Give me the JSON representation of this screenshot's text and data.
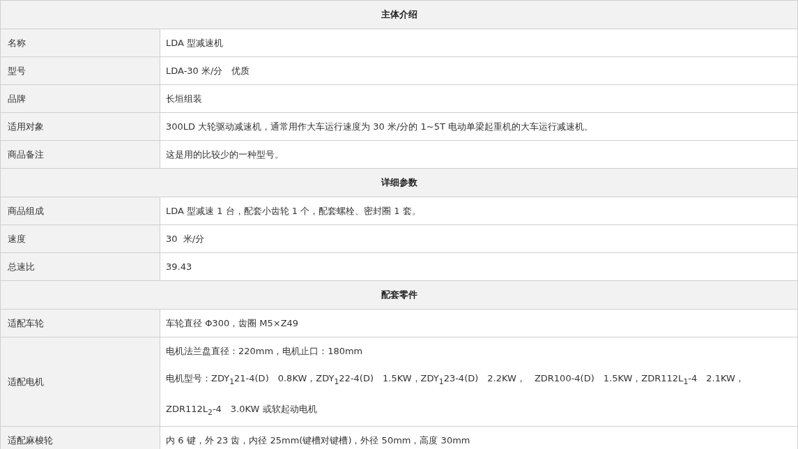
{
  "sections": [
    {
      "title": "主体介绍",
      "rows": [
        {
          "label": "名称",
          "value": [
            "LDA 型减速机"
          ]
        },
        {
          "label": "型号",
          "value": [
            "LDA-30 米/分　优质"
          ]
        },
        {
          "label": "品牌",
          "value": [
            "长垣组装"
          ]
        },
        {
          "label": "适用对象",
          "value": [
            "300LD 大轮驱动减速机，通常用作大车运行速度为 30 米/分的 1~5T 电动单梁起重机的大车运行减速机。"
          ]
        },
        {
          "label": "商品备注",
          "value": [
            "这是用的比较少的一种型号。"
          ]
        }
      ]
    },
    {
      "title": "详细参数",
      "rows": [
        {
          "label": "商品组成",
          "value": [
            "LDA 型减速 1 台，配套小齿轮 1 个，配套螺栓、密封圈 1 套。"
          ]
        },
        {
          "label": "速度",
          "value": [
            "30  米/分"
          ]
        },
        {
          "label": "总速比",
          "value": [
            "39.43"
          ]
        }
      ]
    },
    {
      "title": "配套零件",
      "rows": [
        {
          "label": "适配车轮",
          "value": [
            "车轮直径 Φ300，齿圈 M5×Z49"
          ]
        },
        {
          "label": "适配电机",
          "value": [
            "电机法兰盘直径：220mm，电机止口：180mm",
            "电机型号：ZDY$_{1}$21-4(D)　0.8KW，ZDY$_{1}$22-4(D)　1.5KW，ZDY$_{1}$23-4(D)　2.2KW，　ZDR100-4(D)　1.5KW，ZDR112L$_{1}$-4　2.1KW，",
            "ZDR112L$_{2}$-4　3.0KW 或软起动电机"
          ]
        },
        {
          "label": "适配麻梭轮",
          "value": [
            "内 6 键，外 23 齿，内径 25mm(键槽对键槽)，外径 50mm，高度 30mm"
          ]
        }
      ]
    }
  ]
}
